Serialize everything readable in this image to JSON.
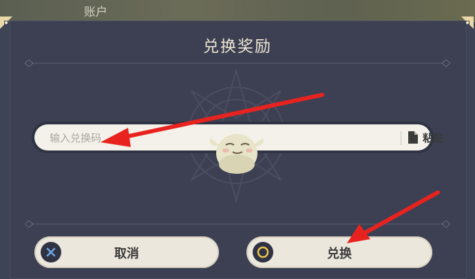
{
  "header": {
    "account_label": "账户"
  },
  "dialog": {
    "title": "兑换奖励",
    "code_input": {
      "placeholder": "输入兑换码",
      "value": ""
    },
    "paste_label": "粘贴",
    "cancel_label": "取消",
    "confirm_label": "兑换"
  },
  "colors": {
    "dialog_bg": "#3c4052",
    "text_light": "#ece5d2",
    "button_bg": "#ece7dc",
    "annotation_red": "#e8231f"
  },
  "icons": {
    "paste": "document-icon",
    "cancel": "cross-circle-icon",
    "confirm": "ring-circle-icon",
    "mascot": "paimon-sticker-icon"
  }
}
